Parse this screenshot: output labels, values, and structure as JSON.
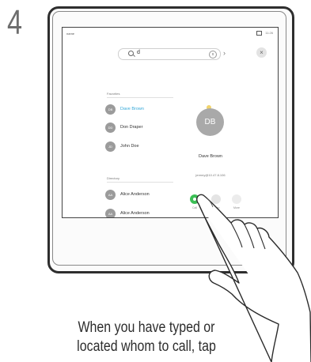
{
  "step_number": "4",
  "instruction": {
    "line1": "When you have typed or",
    "line2": "located whom to call, tap"
  },
  "device": {
    "status_bar": {
      "left": "name",
      "right": "11:26"
    },
    "search": {
      "value": "d",
      "clear_label": "x",
      "arrow": "›"
    },
    "close_label": "×",
    "sections": {
      "favorites_label": "Favorites",
      "directory_label": "Directory"
    },
    "contacts": [
      {
        "initials": "DB",
        "name": "Dave Brown",
        "selected": true
      },
      {
        "initials": "DD",
        "name": "Don Draper",
        "selected": false
      },
      {
        "initials": "JD",
        "name": "John Doe",
        "selected": false
      },
      {
        "initials": "AA",
        "name": "Alice Anderson",
        "selected": false
      },
      {
        "initials": "AA",
        "name": "Alice Anderson",
        "selected": false
      }
    ],
    "detail": {
      "initials": "DB",
      "name": "Dave Brown",
      "address": "jeremy@10.47.8.106",
      "actions": [
        "Call",
        "Video",
        "More"
      ]
    },
    "colors": {
      "accent": "#35a8d8",
      "call_button": "#3bbf55",
      "favorite_star": "#f2d46b"
    },
    "icons": [
      "search-icon",
      "clear-icon",
      "close-icon",
      "star-icon",
      "call-icon",
      "hand-pointer-icon"
    ]
  }
}
